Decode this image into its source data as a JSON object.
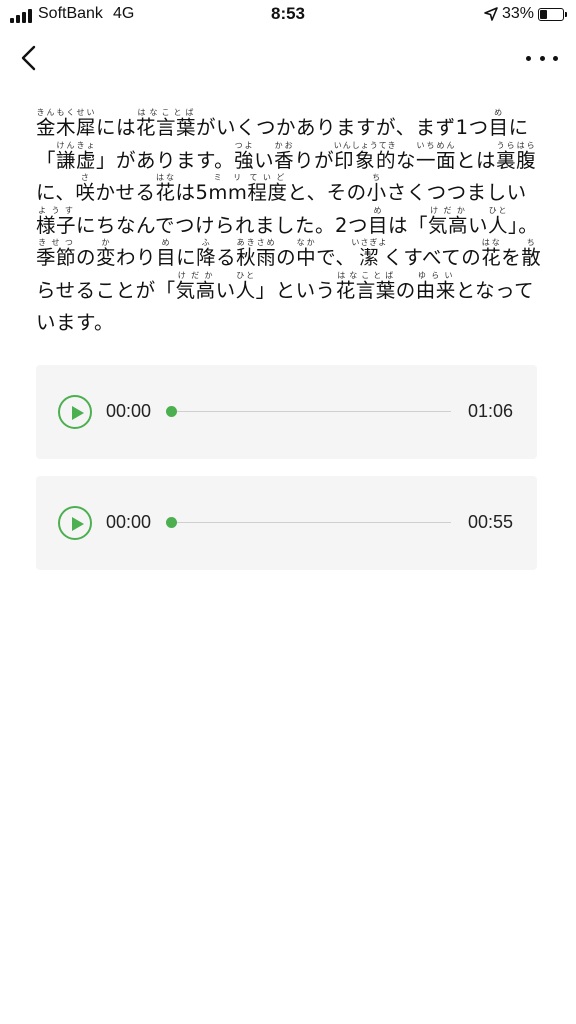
{
  "status_bar": {
    "carrier": "SoftBank",
    "network": "4G",
    "time": "8:53",
    "battery_percent": "33%",
    "battery_level": 0.33
  },
  "nav": {
    "back_icon": "chevron-left-icon",
    "more_icon": "ellipsis-icon"
  },
  "article": {
    "segments": [
      [
        "金木犀",
        "きんもくせい"
      ],
      [
        "には"
      ],
      [
        "花言葉",
        "はなことば"
      ],
      [
        "がいくつかありますが、まず1つ"
      ],
      [
        "目",
        "め"
      ],
      [
        "に"
      ],
      [
        "「"
      ],
      [
        "謙虚",
        "けんきょ"
      ],
      [
        "」があります。"
      ],
      [
        "強",
        "つよ"
      ],
      [
        "い"
      ],
      [
        "香",
        "かお"
      ],
      [
        "りが"
      ],
      [
        "印象的",
        "いんしょうてき"
      ],
      [
        "な"
      ],
      [
        "一面",
        "いちめん"
      ],
      [
        "とは"
      ],
      [
        "裏腹",
        "うらはら"
      ],
      [
        "に、"
      ],
      [
        "咲",
        "さ"
      ],
      [
        "かせる"
      ],
      [
        "花",
        "はな"
      ],
      [
        "は5"
      ],
      [
        "mm",
        "ミリ"
      ],
      [
        "程度",
        "ていど"
      ],
      [
        "と、その"
      ],
      [
        "小",
        "ち"
      ],
      [
        "さくつつ"
      ],
      [
        "ましい"
      ],
      [
        "様子",
        "ようす"
      ],
      [
        "にちなんでつけられました。2つ"
      ],
      [
        "目",
        "め"
      ],
      [
        "は"
      ],
      [
        "「"
      ],
      [
        "気高",
        "けだか"
      ],
      [
        "い"
      ],
      [
        "人",
        "ひと"
      ],
      [
        "」。"
      ],
      [
        "季節",
        "きせつ"
      ],
      [
        "の"
      ],
      [
        "変",
        "か"
      ],
      [
        "わり"
      ],
      [
        "目",
        "め"
      ],
      [
        "に"
      ],
      [
        "降",
        "ふ"
      ],
      [
        "る"
      ],
      [
        "秋雨",
        "あきさめ"
      ],
      [
        "の"
      ],
      [
        "中",
        "なか"
      ],
      [
        "で、"
      ],
      [
        "潔",
        "いさぎよ"
      ],
      [
        "くすべての"
      ],
      [
        "花",
        "はな"
      ],
      [
        "を"
      ],
      [
        "散",
        "ち"
      ],
      [
        "らせることが「"
      ],
      [
        "気高",
        "けだか"
      ],
      [
        "い"
      ],
      [
        "人",
        "ひと"
      ],
      [
        "」という"
      ],
      [
        "花言葉",
        "はなことば"
      ],
      [
        "の"
      ],
      [
        "由来",
        "ゆらい"
      ],
      [
        "となっています。"
      ]
    ]
  },
  "audio_players": [
    {
      "play_icon": "play-icon",
      "current_time": "00:00",
      "duration": "01:06",
      "progress": 0
    },
    {
      "play_icon": "play-icon",
      "current_time": "00:00",
      "duration": "00:55",
      "progress": 0
    }
  ],
  "colors": {
    "accent": "#4caf50",
    "card_bg": "#f5f5f5",
    "text": "#111111"
  }
}
